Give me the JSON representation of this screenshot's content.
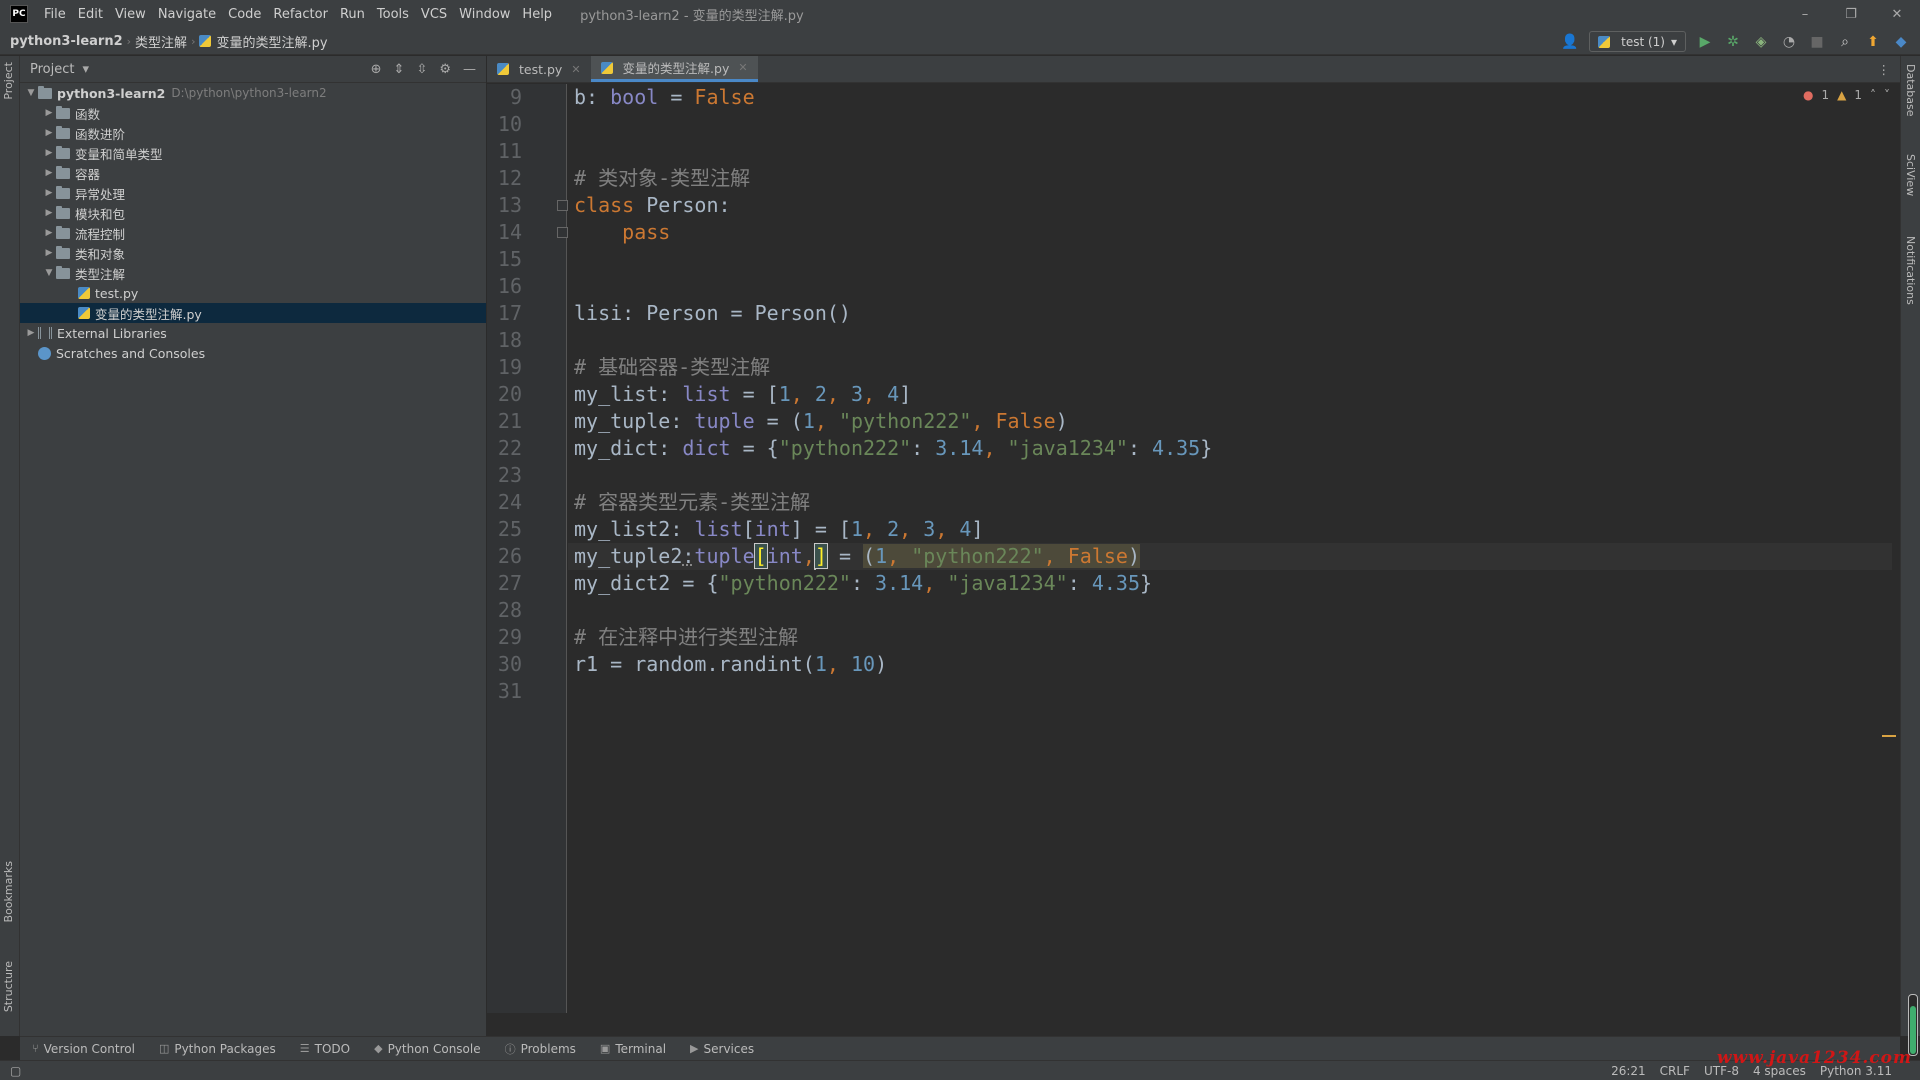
{
  "app": {
    "logo_text": "PC",
    "window_title": "python3-learn2 - 变量的类型注解.py"
  },
  "menu": [
    "File",
    "Edit",
    "View",
    "Navigate",
    "Code",
    "Refactor",
    "Run",
    "Tools",
    "VCS",
    "Window",
    "Help"
  ],
  "window_controls": {
    "minimize": "–",
    "restore": "❐",
    "close": "✕"
  },
  "breadcrumb": {
    "project": "python3-learn2",
    "folder": "类型注解",
    "file": "变量的类型注解.py"
  },
  "run_config": {
    "label": "test (1)"
  },
  "left_strip": {
    "project": "Project",
    "bookmarks": "Bookmarks",
    "structure": "Structure"
  },
  "right_strip": {
    "database": "Database",
    "sciview": "SciView",
    "notifications": "Notifications"
  },
  "project_panel": {
    "title": "Project",
    "root": {
      "name": "python3-learn2",
      "path": "D:\\python\\python3-learn2"
    },
    "folders": [
      "函数",
      "函数进阶",
      "变量和简单类型",
      "容器",
      "异常处理",
      "模块和包",
      "流程控制",
      "类和对象"
    ],
    "expanded_folder": "类型注解",
    "files": [
      "test.py",
      "变量的类型注解.py"
    ],
    "external_libraries": "External Libraries",
    "scratches": "Scratches and Consoles"
  },
  "editor": {
    "tabs": [
      {
        "label": "test.py",
        "active": false
      },
      {
        "label": "变量的类型注解.py",
        "active": true
      }
    ],
    "inspections": {
      "errors": "1",
      "warnings": "1"
    },
    "current_line": 26,
    "lines": [
      {
        "n": "9"
      },
      {
        "n": "10"
      },
      {
        "n": "11"
      },
      {
        "n": "12"
      },
      {
        "n": "13"
      },
      {
        "n": "14"
      },
      {
        "n": "15"
      },
      {
        "n": "16"
      },
      {
        "n": "17"
      },
      {
        "n": "18"
      },
      {
        "n": "19"
      },
      {
        "n": "20"
      },
      {
        "n": "21"
      },
      {
        "n": "22"
      },
      {
        "n": "23"
      },
      {
        "n": "24"
      },
      {
        "n": "25"
      },
      {
        "n": "26"
      },
      {
        "n": "27"
      },
      {
        "n": "28"
      },
      {
        "n": "29"
      },
      {
        "n": "30"
      },
      {
        "n": "31"
      }
    ],
    "code": {
      "l9": [
        [
          "b: ",
          ""
        ],
        [
          "bool",
          "bi"
        ],
        [
          " = ",
          ""
        ],
        [
          "False",
          "kw"
        ]
      ],
      "l12": [
        [
          "# 类对象-类型注解",
          "cmt"
        ]
      ],
      "l13": [
        [
          "class",
          "kw"
        ],
        [
          " Person:",
          ""
        ]
      ],
      "l14": [
        [
          "    ",
          ""
        ],
        [
          "pass",
          "kw"
        ]
      ],
      "l17": [
        [
          "lisi: Person = Person()",
          ""
        ]
      ],
      "l19": [
        [
          "# 基础容器-类型注解",
          "cmt"
        ]
      ],
      "l20": [
        [
          "my_list: ",
          ""
        ],
        [
          "list",
          "bi"
        ],
        [
          " = [",
          ""
        ],
        [
          "1",
          "num"
        ],
        [
          ", ",
          "kw"
        ],
        [
          "2",
          "num"
        ],
        [
          ", ",
          "kw"
        ],
        [
          "3",
          "num"
        ],
        [
          ", ",
          "kw"
        ],
        [
          "4",
          "num"
        ],
        [
          "]",
          ""
        ]
      ],
      "l21": [
        [
          "my_tuple: ",
          ""
        ],
        [
          "tuple",
          "bi"
        ],
        [
          " = (",
          ""
        ],
        [
          "1",
          "num"
        ],
        [
          ", ",
          "kw"
        ],
        [
          "\"python222\"",
          "str"
        ],
        [
          ", ",
          "kw"
        ],
        [
          "False",
          "kw"
        ],
        [
          ")",
          ""
        ]
      ],
      "l22": [
        [
          "my_dict: ",
          ""
        ],
        [
          "dict",
          "bi"
        ],
        [
          " = {",
          ""
        ],
        [
          "\"python222\"",
          "str"
        ],
        [
          ": ",
          ""
        ],
        [
          "3.14",
          "num"
        ],
        [
          ", ",
          "kw"
        ],
        [
          "\"java1234\"",
          "str"
        ],
        [
          ": ",
          ""
        ],
        [
          "4.35",
          "num"
        ],
        [
          "}",
          ""
        ]
      ],
      "l24": [
        [
          "# 容器类型元素-类型注解",
          "cmt"
        ]
      ],
      "l25": [
        [
          "my_list2: ",
          ""
        ],
        [
          "list",
          "bi"
        ],
        [
          "[",
          ""
        ],
        [
          "int",
          "bi"
        ],
        [
          "] = [",
          ""
        ],
        [
          "1",
          "num"
        ],
        [
          ", ",
          "kw"
        ],
        [
          "2",
          "num"
        ],
        [
          ", ",
          "kw"
        ],
        [
          "3",
          "num"
        ],
        [
          ", ",
          "kw"
        ],
        [
          "4",
          "num"
        ],
        [
          "]",
          ""
        ]
      ],
      "l27": [
        [
          "my_dict2 = {",
          ""
        ],
        [
          "\"python222\"",
          "str"
        ],
        [
          ": ",
          ""
        ],
        [
          "3.14",
          "num"
        ],
        [
          ", ",
          "kw"
        ],
        [
          "\"java1234\"",
          "str"
        ],
        [
          ": ",
          ""
        ],
        [
          "4.35",
          "num"
        ],
        [
          "}",
          ""
        ]
      ],
      "l29": [
        [
          "# 在注释中进行类型注解",
          "cmt"
        ]
      ],
      "l30": [
        [
          "r1 = random.randint(",
          ""
        ],
        [
          "1",
          "num"
        ],
        [
          ", ",
          "kw"
        ],
        [
          "10",
          "num"
        ],
        [
          ")",
          ""
        ]
      ]
    },
    "line26": {
      "a": "my_tuple2",
      "colon": ":",
      "type": "tuple",
      "open": "[",
      "int": "int",
      "comma": ",",
      "close": "]",
      "eq": " = ",
      "t_open": "(",
      "t1": "1",
      "t_sep1": ", ",
      "t2": "\"python222\"",
      "t_sep2": ", ",
      "t3": "False",
      "t_close": ")"
    }
  },
  "bottom_tools": [
    "Version Control",
    "Python Packages",
    "TODO",
    "Python Console",
    "Problems",
    "Terminal",
    "Services"
  ],
  "status": {
    "position": "26:21",
    "line_sep": "CRLF",
    "encoding": "UTF-8",
    "indent": "4 spaces",
    "interpreter": "Python 3.11"
  },
  "watermark": "www.java1234.com"
}
